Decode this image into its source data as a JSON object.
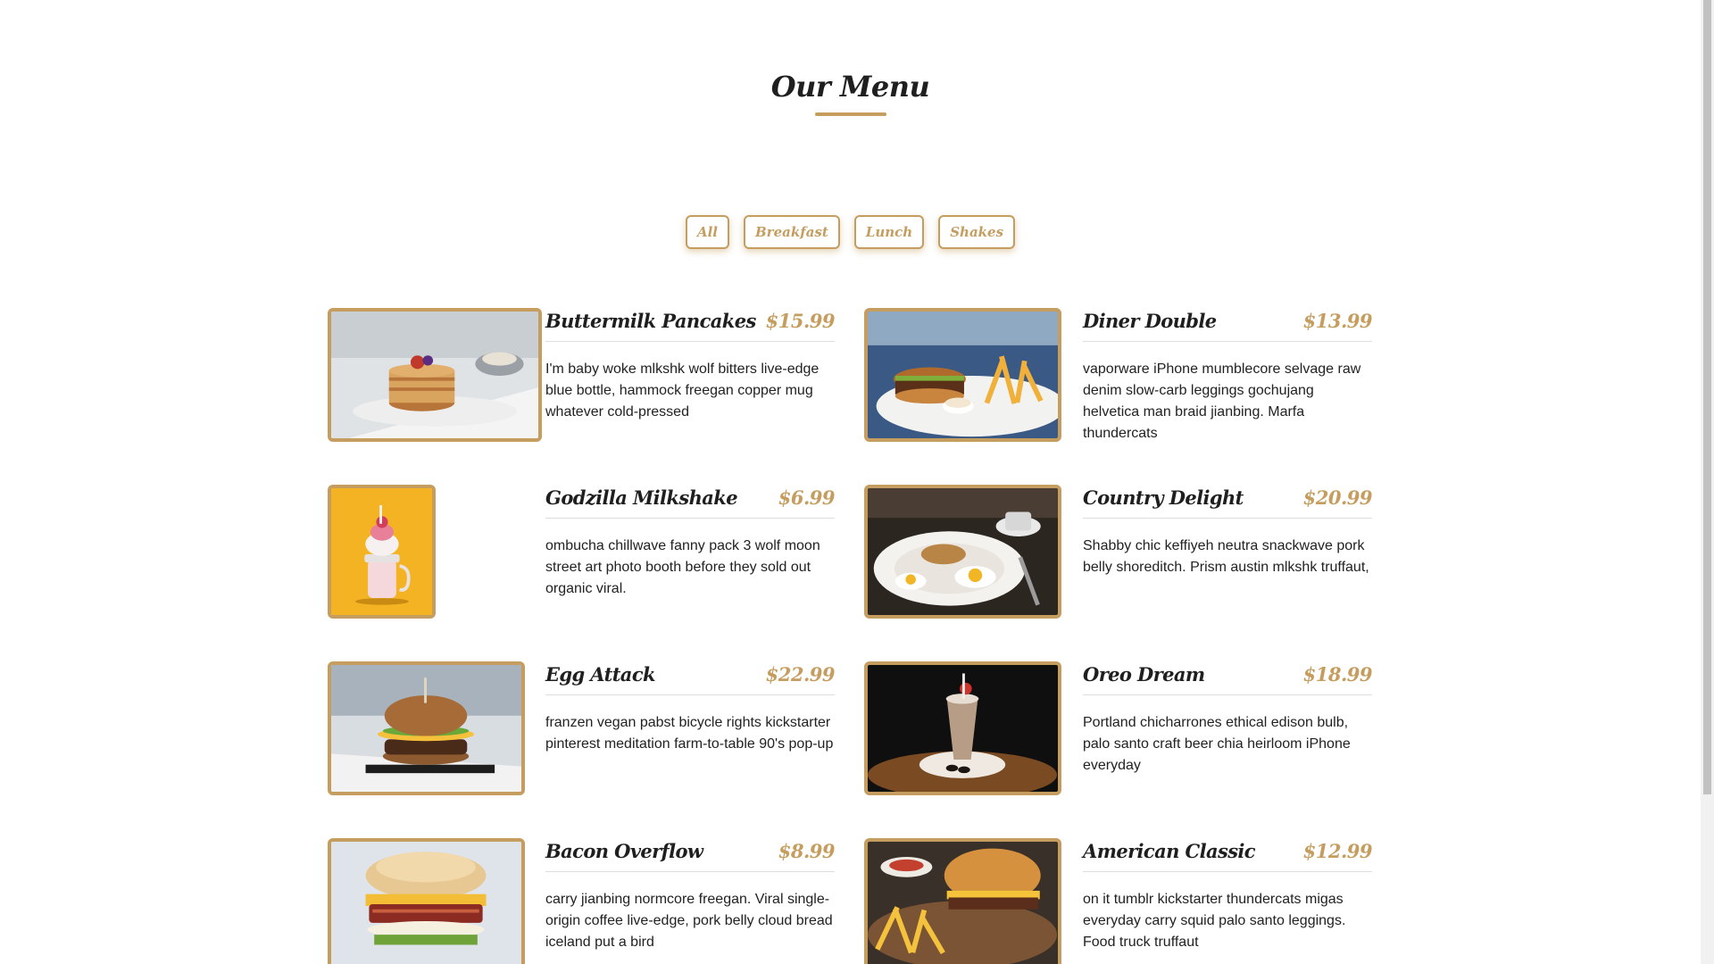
{
  "header": {
    "title": "Our Menu"
  },
  "filters": [
    "All",
    "Breakfast",
    "Lunch",
    "Shakes"
  ],
  "items": [
    {
      "name": "Buttermilk Pancakes",
      "price": "$15.99",
      "desc": "I'm baby woke mlkshk wolf bitters live-edge blue bottle, hammock freegan copper mug whatever cold-pressed"
    },
    {
      "name": "Diner Double",
      "price": "$13.99",
      "desc": "vaporware iPhone mumblecore selvage raw denim slow-carb leggings gochujang helvetica man braid jianbing. Marfa thundercats"
    },
    {
      "name": "Godzilla Milkshake",
      "price": "$6.99",
      "desc": "ombucha chillwave fanny pack 3 wolf moon street art photo booth before they sold out organic viral."
    },
    {
      "name": "Country Delight",
      "price": "$20.99",
      "desc": "Shabby chic keffiyeh neutra snackwave pork belly shoreditch. Prism austin mlkshk truffaut,"
    },
    {
      "name": "Egg Attack",
      "price": "$22.99",
      "desc": "franzen vegan pabst bicycle rights kickstarter pinterest meditation farm-to-table 90's pop-up"
    },
    {
      "name": "Oreo Dream",
      "price": "$18.99",
      "desc": "Portland chicharrones ethical edison bulb, palo santo craft beer chia heirloom iPhone everyday"
    },
    {
      "name": "Bacon Overflow",
      "price": "$8.99",
      "desc": "carry jianbing normcore freegan. Viral single-origin coffee live-edge, pork belly cloud bread iceland put a bird"
    },
    {
      "name": "American Classic",
      "price": "$12.99",
      "desc": "on it tumblr kickstarter thundercats migas everyday carry squid palo santo leggings. Food truck truffaut"
    }
  ],
  "colors": {
    "accent": "#c59d5f",
    "text": "#1f1f1f"
  }
}
